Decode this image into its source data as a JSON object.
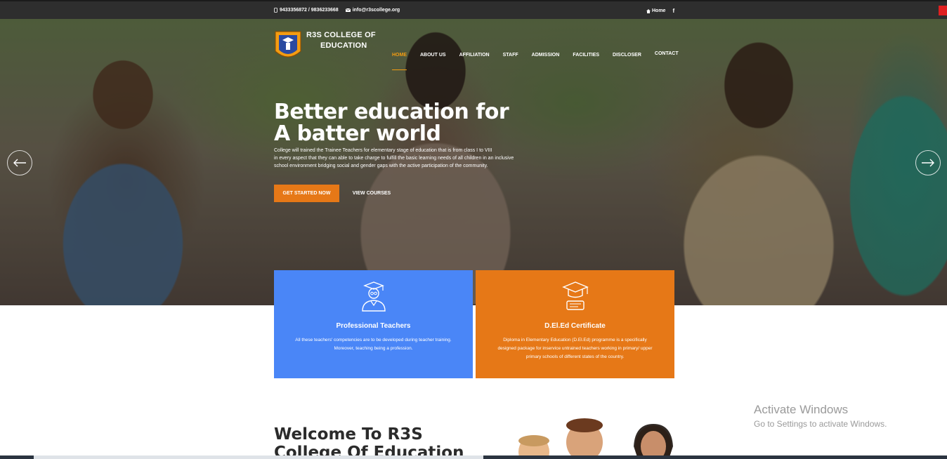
{
  "topbar": {
    "phone": "9433356872 / 9836233668",
    "email": "info@r3scollege.org",
    "home_label": "Home",
    "facebook_label": "f"
  },
  "logo": {
    "line1": "R3S COLLEGE OF",
    "line2": "EDUCATION"
  },
  "nav": {
    "items": [
      "HOME",
      "ABOUT US",
      "AFFILIATION",
      "STAFF",
      "ADMISSION",
      "FACILITIES",
      "DISCLOSER",
      "CONTACT"
    ],
    "active": "HOME"
  },
  "hero": {
    "headline_line1": "Better education for",
    "headline_line2": "A batter world",
    "subtext_line1": "College will trained the Trainee Teachers for elementary stage of education that is from class I to VIII",
    "subtext_line2": "in every aspect that they can able to take charge to fulfill the basic learning needs of all children in an inclusive",
    "subtext_line3": "school environment bridging social and gender gaps with the active participation of the community.",
    "primary_button": "GET STARTED NOW",
    "secondary_button": "VIEW COURSES"
  },
  "cards": [
    {
      "title": "Professional Teachers",
      "text_line1": "All these teachers' competencies are to be developed during teacher training.",
      "text_line2": "Moreover, teaching being a profession.",
      "text_line3": "",
      "icon": "graduate-teacher-icon",
      "color": "#4a86f7"
    },
    {
      "title": "D.El.Ed Certificate",
      "text_line1": "Diploma in Elementary Education (D.El.Ed) programme is a specifically",
      "text_line2": "designed package for inservice untrained teachers working in primary/ upper",
      "text_line3": "primary schools of different states of the country.",
      "icon": "graduation-certificate-icon",
      "color": "#e67817"
    }
  ],
  "welcome": {
    "line1": "Welcome To R3S",
    "line2": "College Of Education"
  },
  "watermark": {
    "line1": "Activate Windows",
    "line2": "Go to Settings to activate Windows."
  },
  "colors": {
    "accent_orange": "#e67817",
    "accent_blue": "#4a86f7",
    "topbar": "#2e2e2e"
  }
}
